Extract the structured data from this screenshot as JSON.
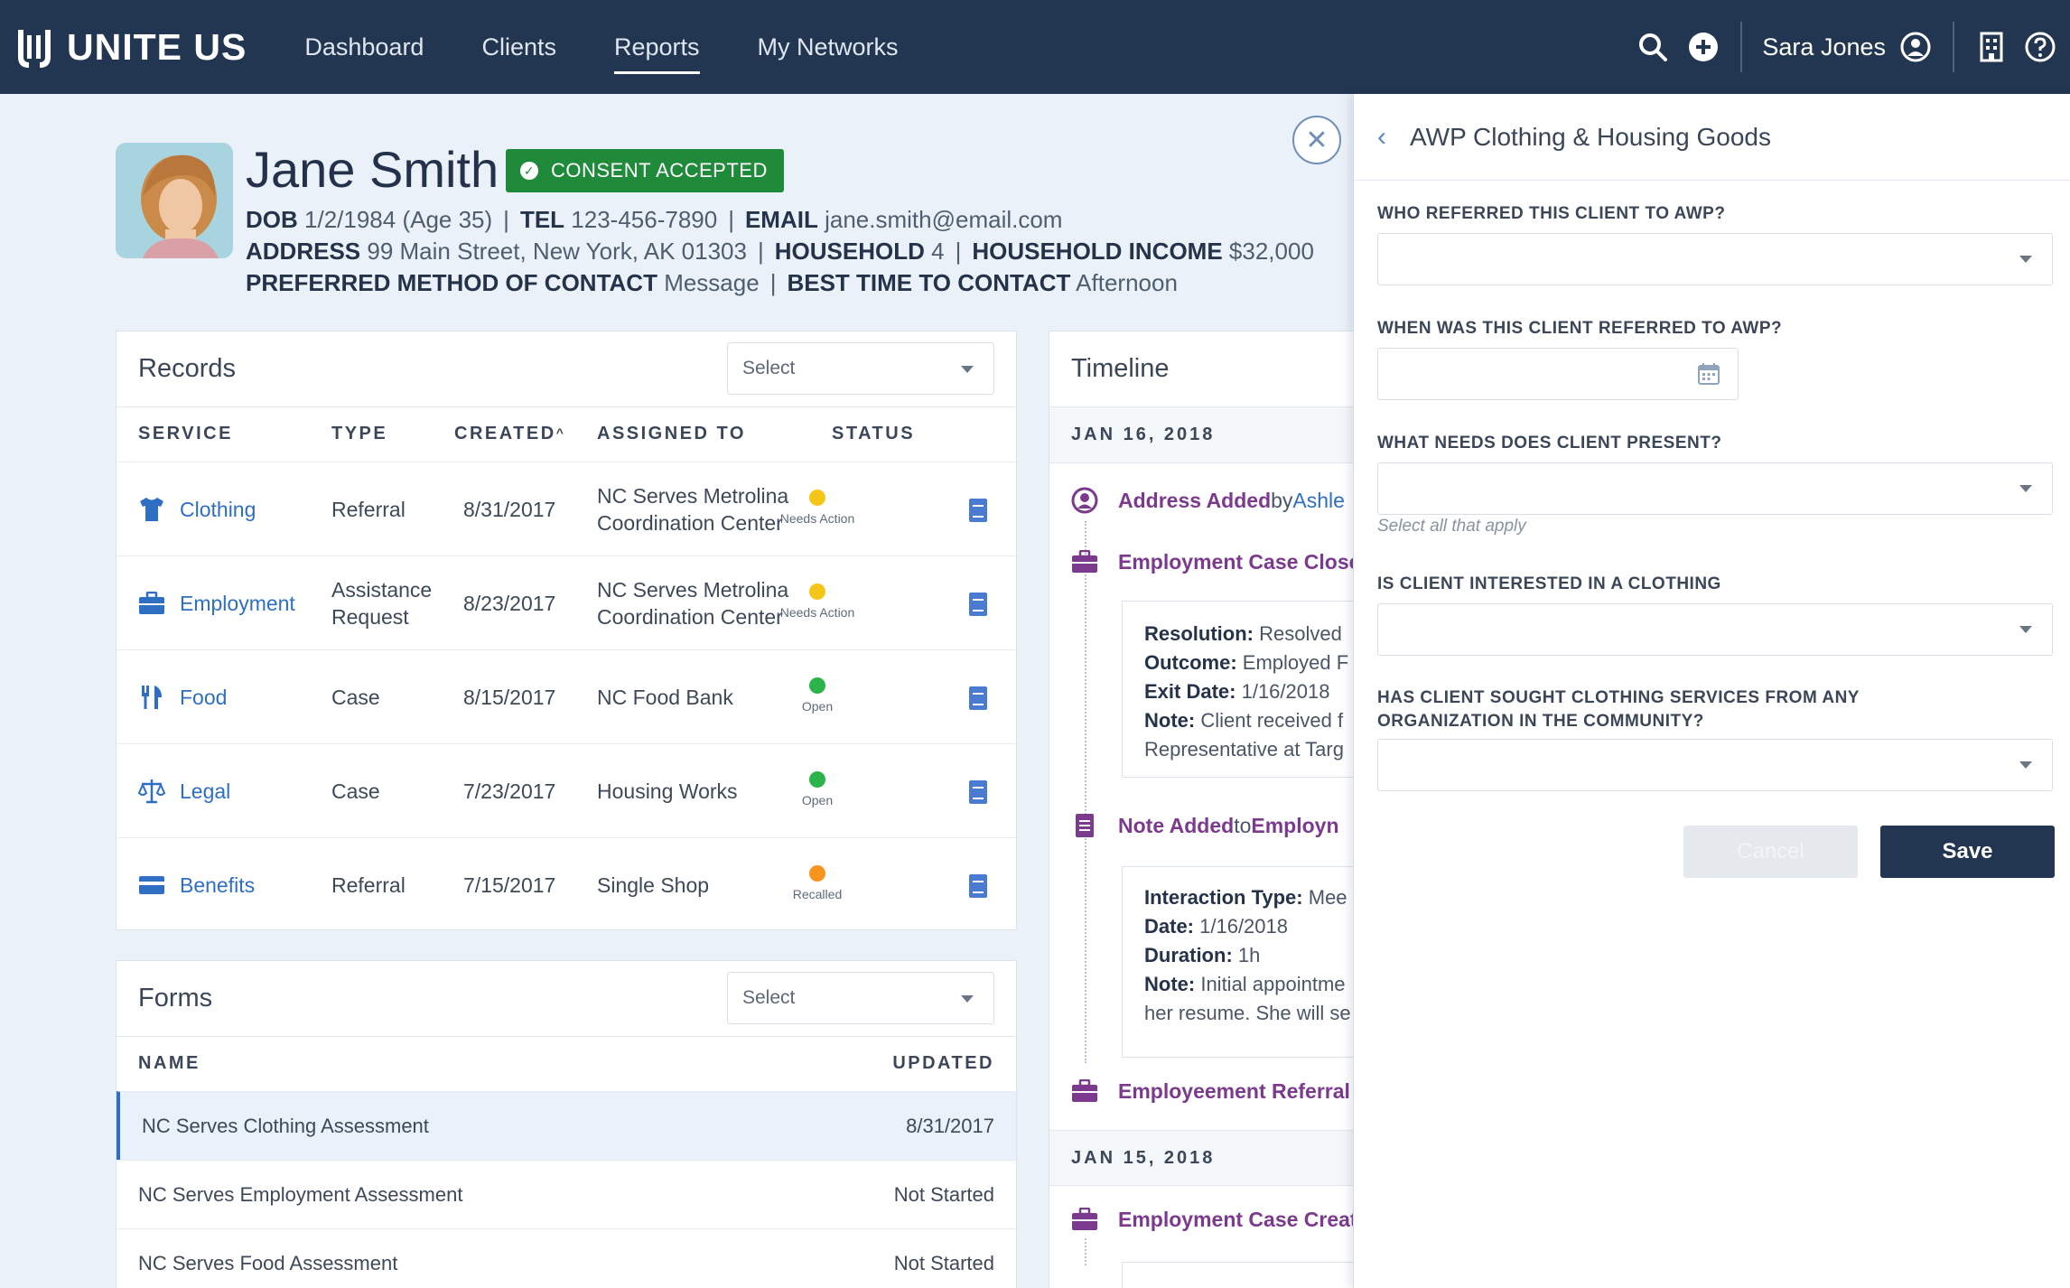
{
  "nav": {
    "logo_text": "UNITE US",
    "links": [
      "Dashboard",
      "Clients",
      "Reports",
      "My Networks"
    ],
    "active_link": "Reports",
    "user_name": "Sara Jones"
  },
  "client": {
    "name": "Jane Smith",
    "consent_label": "CONSENT ACCEPTED",
    "dob_label": "DOB",
    "dob": "1/2/1984 (Age 35)",
    "tel_label": "TEL",
    "tel": "123-456-7890",
    "email_label": "EMAIL",
    "email": "jane.smith@email.com",
    "address_label": "ADDRESS",
    "address": "99 Main Street, New York, AK 01303",
    "household_label": "HOUSEHOLD",
    "household": "4",
    "income_label": "HOUSEHOLD INCOME",
    "income": "$32,000",
    "contact_method_label": "PREFERRED METHOD OF CONTACT",
    "contact_method": "Message",
    "best_time_label": "BEST TIME TO CONTACT",
    "best_time": "Afternoon"
  },
  "records": {
    "title": "Records",
    "select_placeholder": "Select",
    "headers": {
      "service": "SERVICE",
      "type": "TYPE",
      "created": "CREATED",
      "assigned": "ASSIGNED TO",
      "status": "STATUS"
    },
    "rows": [
      {
        "service": "Clothing",
        "icon": "shirt-icon",
        "type": "Referral",
        "created": "8/31/2017",
        "assigned": "NC Serves Metrolina Coordination Center",
        "status": "Needs Action",
        "status_color": "#f5c518"
      },
      {
        "service": "Employment",
        "icon": "briefcase-icon",
        "type": "Assistance Request",
        "created": "8/23/2017",
        "assigned": "NC Serves Metrolina Coordination Center",
        "status": "Needs Action",
        "status_color": "#f5c518"
      },
      {
        "service": "Food",
        "icon": "utensils-icon",
        "type": "Case",
        "created": "8/15/2017",
        "assigned": "NC Food Bank",
        "status": "Open",
        "status_color": "#2cb34a"
      },
      {
        "service": "Legal",
        "icon": "scales-icon",
        "type": "Case",
        "created": "7/23/2017",
        "assigned": "Housing Works",
        "status": "Open",
        "status_color": "#2cb34a"
      },
      {
        "service": "Benefits",
        "icon": "card-icon",
        "type": "Referral",
        "created": "7/15/2017",
        "assigned": "Single Shop",
        "status": "Recalled",
        "status_color": "#f7941d"
      }
    ]
  },
  "forms": {
    "title": "Forms",
    "select_placeholder": "Select",
    "headers": {
      "name": "NAME",
      "updated": "UPDATED"
    },
    "rows": [
      {
        "name": "NC Serves Clothing Assessment",
        "updated": "8/31/2017"
      },
      {
        "name": "NC Serves Employment Assessment",
        "updated": "Not Started"
      },
      {
        "name": "NC Serves Food Assessment",
        "updated": "Not Started"
      }
    ]
  },
  "timeline": {
    "title": "Timeline",
    "date1": "JAN 16, 2018",
    "ev1_a": "Address Added",
    "ev1_b": " by ",
    "ev1_c": "Ashle",
    "ev2": "Employment Case Close",
    "box1": {
      "resolution_label": "Resolution:",
      "resolution": " Resolved",
      "outcome_label": "Outcome:",
      "outcome": " Employed F",
      "exit_label": "Exit Date:",
      "exit": " 1/16/2018",
      "note_label": "Note:",
      "note": " Client received f",
      "note2": "Representative at Targ"
    },
    "ev3_a": "Note Added",
    "ev3_b": " to ",
    "ev3_c": "Employn",
    "box2": {
      "type_label": "Interaction Type:",
      "type": " Mee",
      "date_label": "Date:",
      "date": " 1/16/2018",
      "duration_label": "Duration:",
      "duration": " 1h",
      "note_label": "Note:",
      "note": " Initial appointme",
      "note2": "her resume. She will se"
    },
    "ev4": "Employeement Referral",
    "date2": "JAN 15, 2018",
    "ev5": "Employment Case Creat"
  },
  "panel": {
    "title": "AWP Clothing & Housing Goods",
    "q1": "WHO REFERRED THIS CLIENT TO AWP?",
    "q2": "WHEN WAS THIS CLIENT REFERRED TO AWP?",
    "q3": "WHAT NEEDS DOES CLIENT PRESENT?",
    "q3_hint": "Select all that apply",
    "q4": "IS CLIENT INTERESTED IN A CLOTHING",
    "q5_line1": "HAS CLIENT SOUGHT CLOTHING SERVICES FROM ANY",
    "q5_line2": "ORGANIZATION IN THE COMMUNITY?",
    "cancel_label": "Cancel",
    "save_label": "Save"
  }
}
